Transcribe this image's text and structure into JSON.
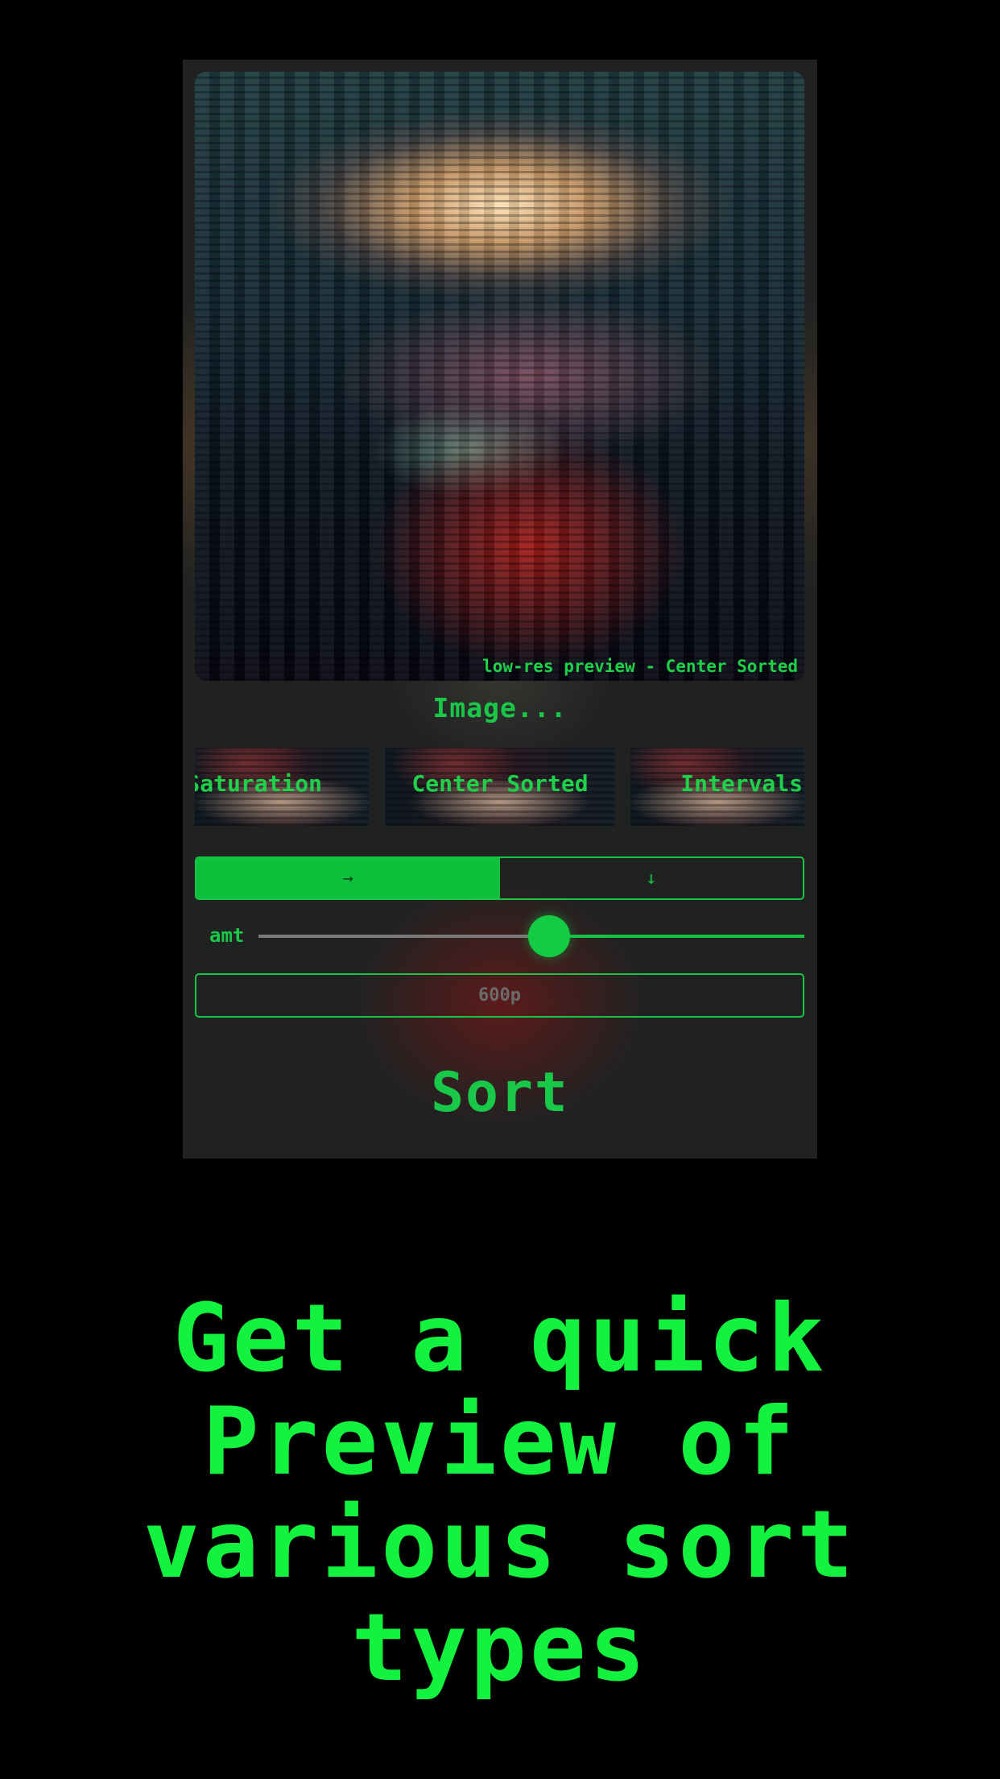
{
  "preview": {
    "caption": "low-res preview - Center Sorted"
  },
  "image_link": "Image...",
  "sort_types": [
    {
      "label": "Saturation"
    },
    {
      "label": "Center Sorted"
    },
    {
      "label": "Intervals"
    }
  ],
  "direction": {
    "options": [
      "→",
      "↓"
    ],
    "selected": "→"
  },
  "amount": {
    "label": "amt",
    "value": 0.5
  },
  "pixels_input": {
    "placeholder": "600p",
    "value": ""
  },
  "sort_button": "Sort",
  "headline": "Get a quick Preview of various sort types",
  "colors": {
    "accent": "#17c444",
    "headline": "#12f23e",
    "background": "#000000",
    "panel": "#202222"
  }
}
